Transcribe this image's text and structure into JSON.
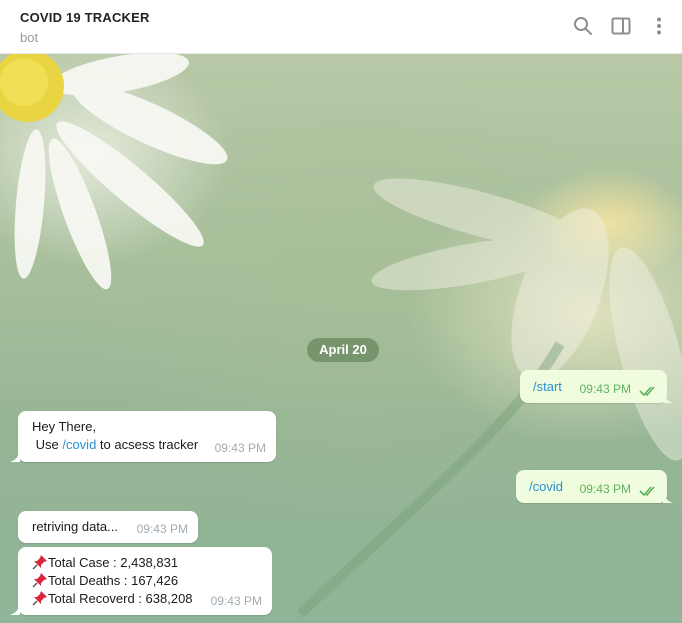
{
  "header": {
    "title": "COVID 19 TRACKER",
    "status": "bot"
  },
  "chat": {
    "date_label": "April 20",
    "messages": [
      {
        "direction": "out",
        "text": "/start",
        "time": "09:43 PM"
      },
      {
        "direction": "in",
        "line1": "Hey There,",
        "line2_prefix": " Use ",
        "line2_link": "/covid",
        "line2_suffix": " to acsess tracker",
        "time": "09:43 PM"
      },
      {
        "direction": "out",
        "text": "/covid",
        "time": "09:43 PM"
      },
      {
        "direction": "in",
        "text": "retriving data...",
        "time": "09:43 PM"
      },
      {
        "direction": "in",
        "lines": [
          "Total Case : 2,438,831",
          "Total Deaths : 167,426",
          "Total Recoverd : 638,208"
        ],
        "time": "09:43 PM"
      }
    ]
  },
  "colors": {
    "outgoing_bubble": "#effdde",
    "incoming_bubble": "#ffffff",
    "link": "#2c8fd1",
    "check_marks": "#5fb15e",
    "date_pill": "#6e8c64"
  },
  "icons": [
    "search-icon",
    "sidebar-panel-icon",
    "more-vertical-icon",
    "pushpin-icon",
    "double-check-icon"
  ]
}
